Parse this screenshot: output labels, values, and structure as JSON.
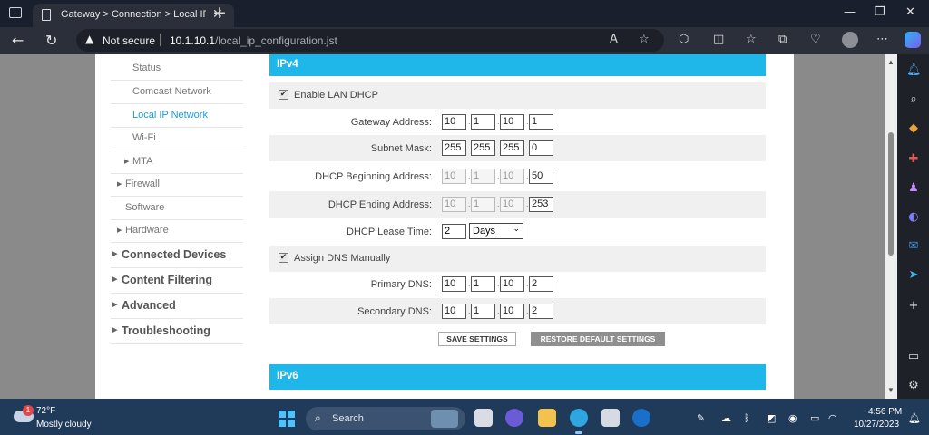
{
  "browser": {
    "tab_title": "Gateway > Connection > Local IP",
    "tab_close": "✕",
    "new_tab": "+",
    "not_secure": "Not secure",
    "url_host": "10.1.10.1",
    "url_path": "/local_ip_configuration.jst"
  },
  "nav": {
    "items": [
      {
        "label": "Status"
      },
      {
        "label": "Comcast Network"
      },
      {
        "label": "Local IP Network"
      },
      {
        "label": "Wi-Fi"
      },
      {
        "label": "MTA"
      },
      {
        "label": "Firewall"
      },
      {
        "label": "Software"
      },
      {
        "label": "Hardware"
      },
      {
        "label": "Connected Devices"
      },
      {
        "label": "Content Filtering"
      },
      {
        "label": "Advanced"
      },
      {
        "label": "Troubleshooting"
      }
    ]
  },
  "ipv4": {
    "title": "IPv4",
    "enable_dhcp_label": "Enable LAN DHCP",
    "enable_dhcp_checked": true,
    "gateway_label": "Gateway Address:",
    "gateway": [
      "10",
      "1",
      "10",
      "1"
    ],
    "subnet_label": "Subnet Mask:",
    "subnet": [
      "255",
      "255",
      "255",
      "0"
    ],
    "dhcp_begin_label": "DHCP Beginning Address:",
    "dhcp_begin": [
      "10",
      "1",
      "10",
      "50"
    ],
    "dhcp_end_label": "DHCP Ending Address:",
    "dhcp_end": [
      "10",
      "1",
      "10",
      "253"
    ],
    "lease_label": "DHCP Lease Time:",
    "lease_value": "2",
    "lease_unit": "Days",
    "assign_dns_label": "Assign DNS Manually",
    "assign_dns_checked": true,
    "primary_dns_label": "Primary DNS:",
    "primary_dns": [
      "10",
      "1",
      "10",
      "2"
    ],
    "secondary_dns_label": "Secondary DNS:",
    "secondary_dns": [
      "10",
      "1",
      "10",
      "2"
    ],
    "save_label": "SAVE SETTINGS",
    "restore_label": "RESTORE DEFAULT SETTINGS"
  },
  "ipv6": {
    "title": "IPv6"
  },
  "taskbar": {
    "weather_temp": "72°F",
    "weather_desc": "Mostly cloudy",
    "weather_badge": "1",
    "search_label": "Search",
    "time": "4:56 PM",
    "date": "10/27/2023"
  },
  "colors": {
    "section_blue": "#1fb6ea",
    "active_link": "#1e9ad6"
  }
}
